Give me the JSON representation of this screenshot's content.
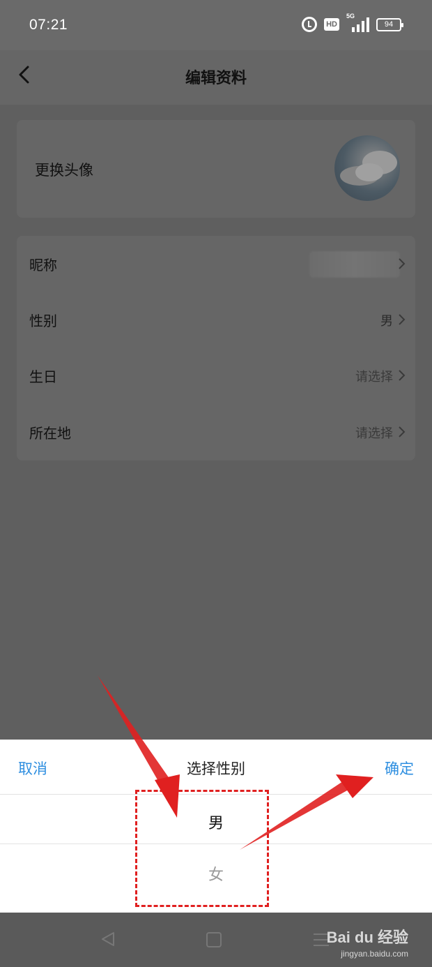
{
  "status_bar": {
    "time": "07:21",
    "icons": [
      "alarm-icon",
      "hd-icon",
      "5g-signal-icon",
      "battery-icon"
    ],
    "network_label": "5G",
    "hd_label": "HD",
    "battery_level": "94"
  },
  "header": {
    "title": "编辑资料",
    "back_icon": "chevron-left-icon"
  },
  "avatar_card": {
    "label": "更换头像"
  },
  "profile_rows": [
    {
      "label": "昵称",
      "value": ""
    },
    {
      "label": "性别",
      "value": "男"
    },
    {
      "label": "生日",
      "value": "请选择"
    },
    {
      "label": "所在地",
      "value": "请选择"
    }
  ],
  "gender_sheet": {
    "cancel_label": "取消",
    "title": "选择性别",
    "confirm_label": "确定",
    "options": [
      "男",
      "女"
    ],
    "selected": "男"
  },
  "watermark": {
    "brand": "Bai du 经验",
    "url": "jingyan.baidu.com"
  },
  "colors": {
    "accent_blue": "#2f8fe0",
    "annotation_red": "#e02020",
    "overlay_gray": "#666666"
  }
}
